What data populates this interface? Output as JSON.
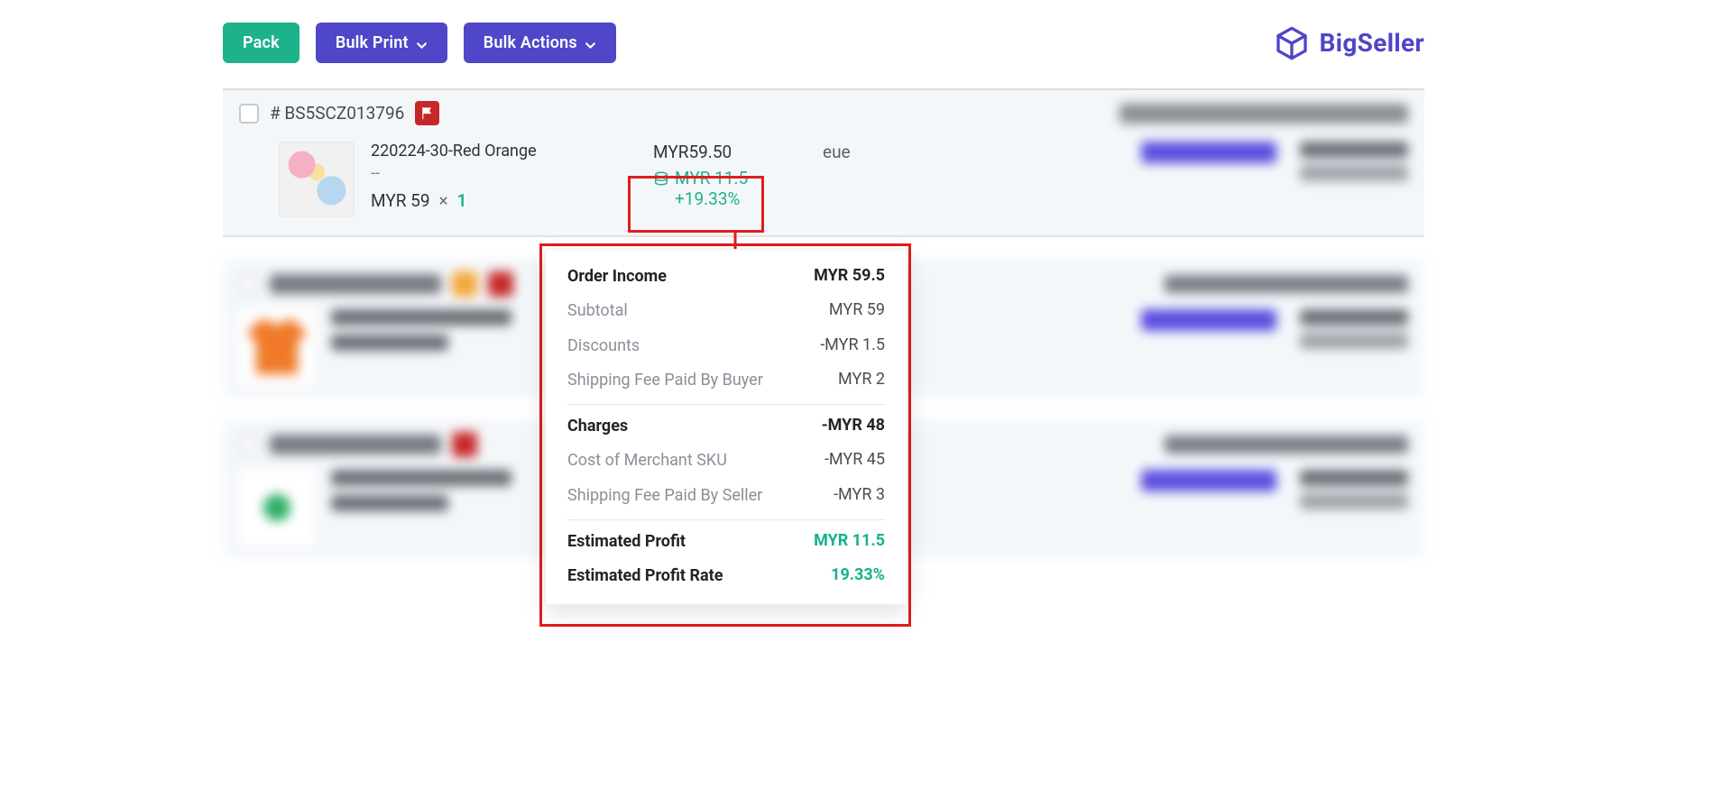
{
  "brand": {
    "name": "BigSeller"
  },
  "toolbar": {
    "pack": "Pack",
    "bulk_print": "Bulk Print",
    "bulk_actions": "Bulk Actions"
  },
  "order": {
    "number_prefix": "#",
    "number": "BS5SCZ013796",
    "product": {
      "name": "220224-30-Red Orange",
      "variant": "--",
      "currency": "MYR",
      "price": "59",
      "times": "×",
      "qty": "1"
    },
    "amount": {
      "total": "MYR59.50",
      "profit": "MYR 11.5",
      "rate": "+19.33%"
    },
    "buyer": "eue"
  },
  "breakdown": {
    "income_label": "Order Income",
    "income_value": "MYR 59.5",
    "subtotal_label": "Subtotal",
    "subtotal_value": "MYR 59",
    "discounts_label": "Discounts",
    "discounts_value": "-MYR 1.5",
    "ship_buyer_label": "Shipping Fee Paid By Buyer",
    "ship_buyer_value": "MYR 2",
    "charges_label": "Charges",
    "charges_value": "-MYR 48",
    "cost_sku_label": "Cost of Merchant SKU",
    "cost_sku_value": "-MYR 45",
    "ship_seller_label": "Shipping Fee Paid By Seller",
    "ship_seller_value": "-MYR 3",
    "est_profit_label": "Estimated Profit",
    "est_profit_value": "MYR 11.5",
    "est_rate_label": "Estimated Profit Rate",
    "est_rate_value": "19.33%"
  },
  "colors": {
    "green": "#1eb28a",
    "indigo": "#4f46c8",
    "red": "#e11d1d"
  }
}
